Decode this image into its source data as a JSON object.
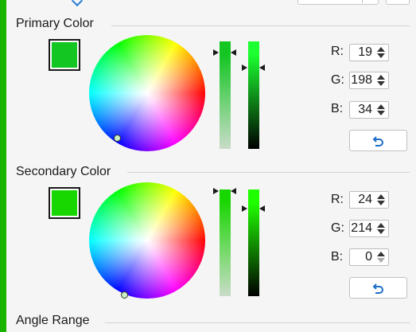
{
  "top_partial": {
    "field_value": "",
    "button_label": ""
  },
  "primary": {
    "title": "Primary Color",
    "swatch_color": "#13c622",
    "rgb": {
      "r_label": "R:",
      "r_value": "19",
      "g_label": "G:",
      "g_value": "198",
      "b_label": "B:",
      "b_value": "34"
    },
    "reset_icon": "undo-arrow-icon"
  },
  "secondary": {
    "title": "Secondary Color",
    "swatch_color": "#18d600",
    "rgb": {
      "r_label": "R:",
      "r_value": "24",
      "g_label": "G:",
      "g_value": "214",
      "b_label": "B:",
      "b_value": "0"
    },
    "reset_icon": "undo-arrow-icon"
  },
  "angle_range": {
    "title": "Angle Range"
  },
  "colors": {
    "accent": "#2a7fd4",
    "left_strip": "#18b400",
    "reset_icon": "#1e6fc8"
  }
}
